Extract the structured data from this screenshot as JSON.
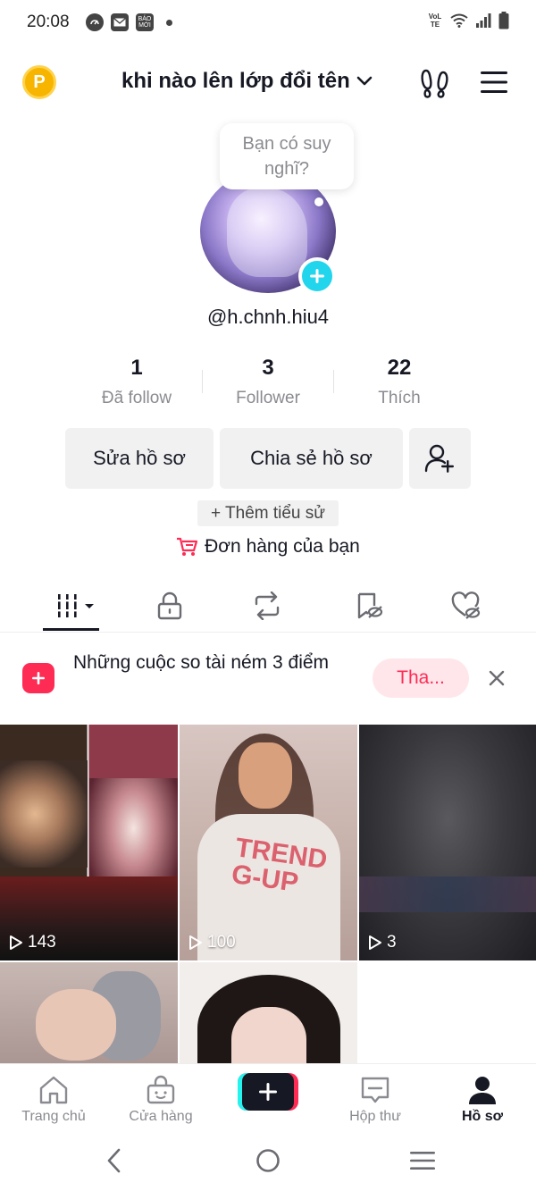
{
  "status_bar": {
    "time": "20:08",
    "left_icons": [
      "speed-icon",
      "mail-icon",
      "baomoi-icon",
      "dot-icon"
    ],
    "baomoi_text": "BÁO\nMỚI",
    "volte_text": "VoLTE",
    "right_icons": [
      "volte-icon",
      "wifi-icon",
      "signal-icon",
      "battery-icon"
    ]
  },
  "header": {
    "coin_letter": "P",
    "title": "khi nào lên lớp đổi tên"
  },
  "profile": {
    "bubble_text": "Bạn có suy nghĩ?",
    "username": "@h.chnh.hiu4"
  },
  "stats": [
    {
      "value": "1",
      "label": "Đã follow"
    },
    {
      "value": "3",
      "label": "Follower"
    },
    {
      "value": "22",
      "label": "Thích"
    }
  ],
  "actions": {
    "edit": "Sửa hồ sơ",
    "share": "Chia sẻ hồ sơ",
    "bio": "+ Thêm tiểu sử",
    "orders": "Đơn hàng của bạn"
  },
  "banner": {
    "text": "Những cuộc so tài ném 3 điểm",
    "button": "Tha..."
  },
  "videos": [
    {
      "views": "143"
    },
    {
      "views": "100"
    },
    {
      "views": "3"
    }
  ],
  "thumb_text": "TREND\nG-UP",
  "bottom_nav": [
    {
      "label": "Trang chủ"
    },
    {
      "label": "Cửa hàng"
    },
    {
      "label": "Hộp thư"
    },
    {
      "label": "Hồ sơ"
    }
  ],
  "colors": {
    "accent": "#fe2c55",
    "cyan": "#20d5ec",
    "coin": "#f7b500",
    "text": "#161823",
    "muted": "#8a8b91"
  }
}
